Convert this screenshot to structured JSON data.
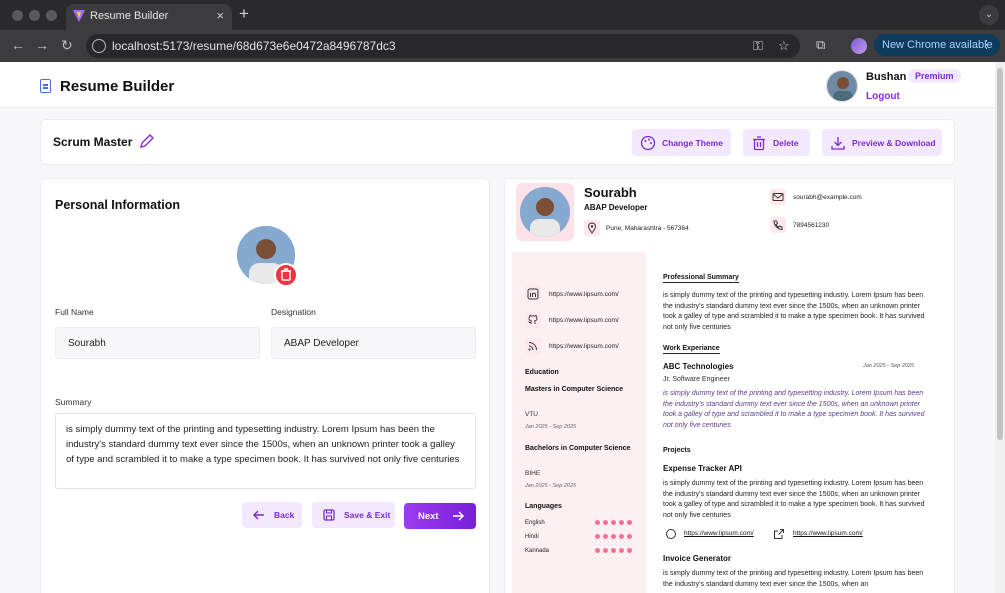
{
  "browser": {
    "tab_title": "Resume Builder",
    "url": "localhost:5173/resume/68d673e6e0472a8496787dc3",
    "update_label": "New Chrome available"
  },
  "header": {
    "app_title": "Resume Builder",
    "user_name": "Bushan",
    "premium_label": "Premium",
    "logout_label": "Logout"
  },
  "toolbar": {
    "resume_title": "Scrum Master",
    "change_theme_label": "Change Theme",
    "delete_label": "Delete",
    "preview_download_label": "Preview & Download"
  },
  "form": {
    "section_title": "Personal Information",
    "full_name_label": "Full Name",
    "full_name_value": "Sourabh",
    "designation_label": "Designation",
    "designation_value": "ABAP Developer",
    "summary_label": "Summary",
    "summary_value": "is simply dummy text of the printing and typesetting industry. Lorem Ipsum has been the industry's standard dummy text ever since the 1500s, when an unknown printer took a galley of type and scrambled it to make a type specimen book. It has survived not only five centuries",
    "back_label": "Back",
    "save_exit_label": "Save & Exit",
    "next_label": "Next"
  },
  "preview": {
    "name": "Sourabh",
    "role": "ABAP Developer",
    "location": "Pune, Maharashtra - 567364",
    "email": "sourabh@example.com",
    "phone": "7894561230",
    "links": [
      "https://www.lipsum.com/",
      "https://www.lipsum.com/",
      "https://www.lipsum.com/"
    ],
    "education_title": "Education",
    "education": [
      {
        "degree": "Masters in Computer Science",
        "school": "VTU",
        "dates": "Jan 2025 - Sep 2025"
      },
      {
        "degree": "Bachelors in Computer Science",
        "school": "BIHE",
        "dates": "Jan 2025 - Sep 2025"
      }
    ],
    "languages_title": "Languages",
    "languages": [
      "English",
      "Hindi",
      "Kannada"
    ],
    "summary_title": "Professional Summary",
    "summary": "is simply dummy text of the printing and typesetting industry. Lorem Ipsum has been the industry's standard dummy text ever since the 1500s, when an unknown printer took a galley of type and scrambled it to make a type specimen book. It has survived not only five centuries",
    "work_title": "Work Experiance",
    "work": {
      "company": "ABC Technologies",
      "dates": "Jan 2025 - Sep 2025",
      "position": "Jr. Software Engineer",
      "description": "is simply dummy text of the printing and typesetting industry. Lorem Ipsum has been the industry's standard dummy text ever since the 1500s, when an unknown printer took a galley of type and scrambled it to make a type specimen book. It has survived not only five centuries"
    },
    "projects_title": "Projects",
    "projects": [
      {
        "name": "Expense Tracker API",
        "description": "is simply dummy text of the printing and typesetting industry. Lorem Ipsum has been the industry's standard dummy text ever since the 1500s, when an unknown printer took a galley of type and scrambled it to make a type specimen book. It has survived not only five centuries",
        "github": "https://www.lipsum.com/",
        "live": "https://www.lipsum.com/"
      },
      {
        "name": "Invoice Generator",
        "description": "is simply dummy text of the printing and typesetting industry. Lorem Ipsum has been the industry's standard dummy text ever since the 1500s, when an"
      }
    ]
  },
  "colors": {
    "accent": "#8a2be2",
    "pink_bg": "#fdf0f2",
    "danger": "#ef3340"
  }
}
